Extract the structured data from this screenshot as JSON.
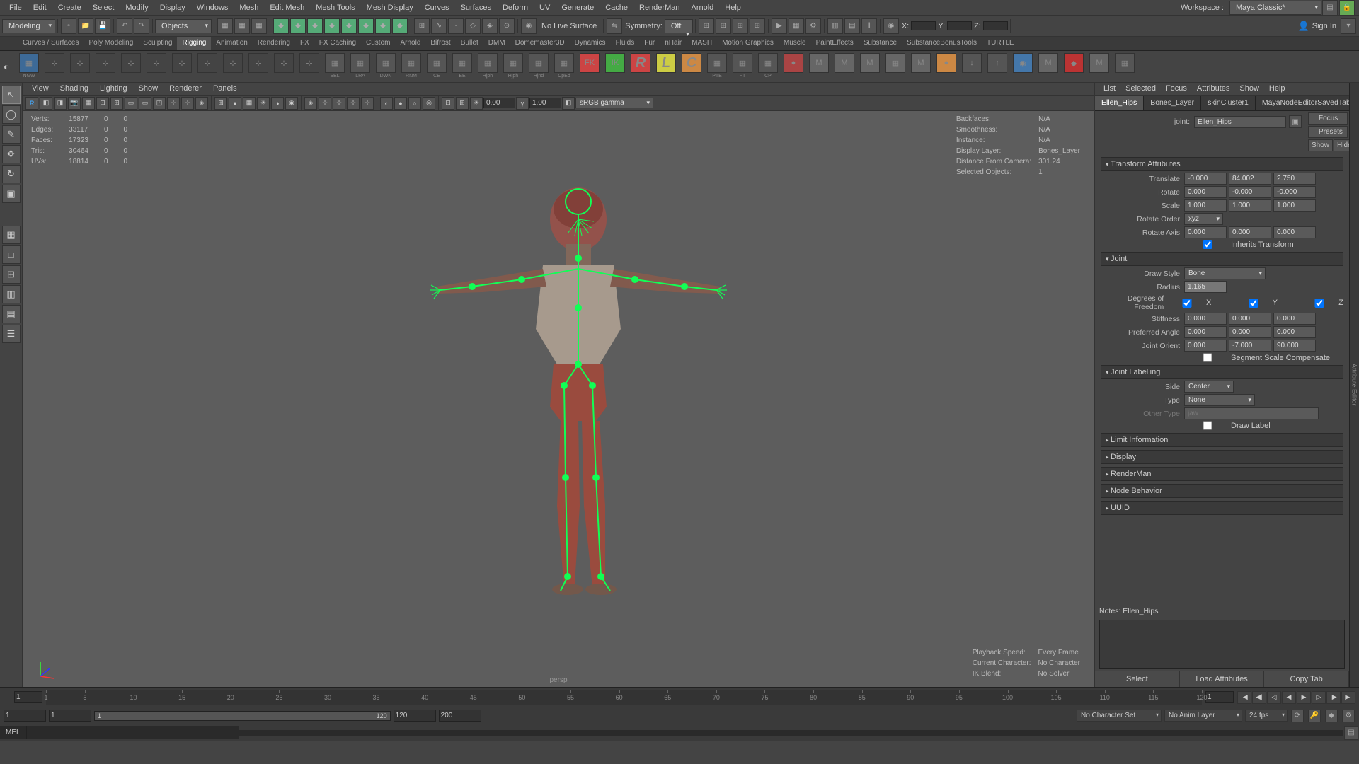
{
  "menubar": [
    "File",
    "Edit",
    "Create",
    "Select",
    "Modify",
    "Display",
    "Windows",
    "Mesh",
    "Edit Mesh",
    "Mesh Tools",
    "Mesh Display",
    "Curves",
    "Surfaces",
    "Deform",
    "UV",
    "Generate",
    "Cache",
    "RenderMan",
    "Arnold",
    "Help"
  ],
  "workspace_label": "Workspace :",
  "workspace_value": "Maya Classic*",
  "module_dropdown": "Modeling",
  "toolbar_search": "Objects",
  "status_items": {
    "nolive": "No Live Surface",
    "symmetry_label": "Symmetry:",
    "symmetry_value": "Off",
    "signin": "Sign In"
  },
  "xyz": {
    "x": "X:",
    "y": "Y:",
    "z": "Z:"
  },
  "shelf_tabs": [
    "Curves / Surfaces",
    "Poly Modeling",
    "Sculpting",
    "Rigging",
    "Animation",
    "Rendering",
    "FX",
    "FX Caching",
    "Custom",
    "Arnold",
    "Bifrost",
    "Bullet",
    "DMM",
    "Domemaster3D",
    "Dynamics",
    "Fluids",
    "Fur",
    "nHair",
    "MASH",
    "Motion Graphics",
    "Muscle",
    "PaintEffects",
    "Substance",
    "SubstanceBonusTools",
    "TURTLE"
  ],
  "shelf_active": 3,
  "shelf_icons": [
    {
      "lbl": "NGW",
      "bg": "#3d6a97",
      "txt": "▦"
    },
    {
      "lbl": "",
      "bg": "#444",
      "txt": "⊹"
    },
    {
      "lbl": "",
      "bg": "#444",
      "txt": "⊹"
    },
    {
      "lbl": "",
      "bg": "#444",
      "txt": "⊹"
    },
    {
      "lbl": "",
      "bg": "#444",
      "txt": "⊹"
    },
    {
      "lbl": "",
      "bg": "#444",
      "txt": "⊹"
    },
    {
      "lbl": "",
      "bg": "#444",
      "txt": "⊹"
    },
    {
      "lbl": "",
      "bg": "#444",
      "txt": "⊹"
    },
    {
      "lbl": "",
      "bg": "#444",
      "txt": "⊹"
    },
    {
      "lbl": "",
      "bg": "#444",
      "txt": "⊹"
    },
    {
      "lbl": "",
      "bg": "#444",
      "txt": "⊹"
    },
    {
      "lbl": "",
      "bg": "#444",
      "txt": "⊹"
    },
    {
      "lbl": "SEL",
      "bg": "#555",
      "txt": "▦"
    },
    {
      "lbl": "LRA",
      "bg": "#555",
      "txt": "▦"
    },
    {
      "lbl": "DWN",
      "bg": "#555",
      "txt": "▦"
    },
    {
      "lbl": "RNM",
      "bg": "#555",
      "txt": "▦"
    },
    {
      "lbl": "CE",
      "bg": "#555",
      "txt": "▦"
    },
    {
      "lbl": "EE",
      "bg": "#555",
      "txt": "▦"
    },
    {
      "lbl": "Hjph",
      "bg": "#555",
      "txt": "▦"
    },
    {
      "lbl": "Hjph",
      "bg": "#555",
      "txt": "▦"
    },
    {
      "lbl": "Hjnd",
      "bg": "#555",
      "txt": "▦"
    },
    {
      "lbl": "CpEd",
      "bg": "#555",
      "txt": "▦"
    },
    {
      "lbl": "",
      "bg": "#c44",
      "txt": "FK"
    },
    {
      "lbl": "",
      "bg": "#4a4",
      "txt": "IK"
    },
    {
      "lbl": "",
      "bg": "#c44",
      "txt": "R",
      "big": true
    },
    {
      "lbl": "",
      "bg": "#cc4",
      "txt": "L",
      "big": true
    },
    {
      "lbl": "",
      "bg": "#c84",
      "txt": "C",
      "big": true
    },
    {
      "lbl": "PTE",
      "bg": "#555",
      "txt": "▦"
    },
    {
      "lbl": "FT",
      "bg": "#555",
      "txt": "▦"
    },
    {
      "lbl": "CP",
      "bg": "#555",
      "txt": "▦"
    },
    {
      "lbl": "",
      "bg": "#a44",
      "txt": "●"
    },
    {
      "lbl": "",
      "bg": "#666",
      "txt": "M"
    },
    {
      "lbl": "",
      "bg": "#666",
      "txt": "M"
    },
    {
      "lbl": "",
      "bg": "#666",
      "txt": "M"
    },
    {
      "lbl": "",
      "bg": "#666",
      "txt": "▦"
    },
    {
      "lbl": "",
      "bg": "#666",
      "txt": "M"
    },
    {
      "lbl": "",
      "bg": "#c84",
      "txt": "●"
    },
    {
      "lbl": "",
      "bg": "#555",
      "txt": "↓"
    },
    {
      "lbl": "",
      "bg": "#555",
      "txt": "↑"
    },
    {
      "lbl": "",
      "bg": "#47a",
      "txt": "◉"
    },
    {
      "lbl": "",
      "bg": "#666",
      "txt": "M"
    },
    {
      "lbl": "",
      "bg": "#b33",
      "txt": "◆"
    },
    {
      "lbl": "",
      "bg": "#666",
      "txt": "M"
    },
    {
      "lbl": "",
      "bg": "#555",
      "txt": "▦"
    }
  ],
  "vp_menubar": [
    "View",
    "Shading",
    "Lighting",
    "Show",
    "Renderer",
    "Panels"
  ],
  "vp_toolbar_vals": {
    "exposure": "0.00",
    "gamma": "1.00",
    "colorspace": "sRGB gamma"
  },
  "hud_left": [
    [
      "Verts:",
      "15877",
      "0",
      "0"
    ],
    [
      "Edges:",
      "33117",
      "0",
      "0"
    ],
    [
      "Faces:",
      "17323",
      "0",
      "0"
    ],
    [
      "Tris:",
      "30464",
      "0",
      "0"
    ],
    [
      "UVs:",
      "18814",
      "0",
      "0"
    ]
  ],
  "hud_right": [
    [
      "Backfaces:",
      "N/A"
    ],
    [
      "Smoothness:",
      "N/A"
    ],
    [
      "Instance:",
      "N/A"
    ],
    [
      "Display Layer:",
      "Bones_Layer"
    ],
    [
      "Distance From Camera:",
      "301.24"
    ],
    [
      "Selected Objects:",
      "1"
    ]
  ],
  "hud_br": [
    [
      "Playback Speed:",
      "Every Frame"
    ],
    [
      "Current Character:",
      "No Character"
    ],
    [
      "IK Blend:",
      "No Solver"
    ]
  ],
  "persp_label": "persp",
  "rp_menubar": [
    "List",
    "Selected",
    "Focus",
    "Attributes",
    "Show",
    "Help"
  ],
  "rp_tabs": [
    "Ellen_Hips",
    "Bones_Layer",
    "skinCluster1",
    "MayaNodeEditorSavedTabs"
  ],
  "rp_tabs_active": 0,
  "rp_buttons": {
    "focus": "Focus",
    "presets": "Presets",
    "show": "Show",
    "hide": "Hide"
  },
  "joint_label": "joint:",
  "joint_name": "Ellen_Hips",
  "sections": {
    "transform": "Transform Attributes",
    "joint": "Joint",
    "jointlabel": "Joint Labelling",
    "limit": "Limit Information",
    "display": "Display",
    "renderman": "RenderMan",
    "nodebehavior": "Node Behavior",
    "uuid": "UUID"
  },
  "transform": {
    "translate_lbl": "Translate",
    "translate": [
      "-0.000",
      "84.002",
      "2.750"
    ],
    "rotate_lbl": "Rotate",
    "rotate": [
      "0.000",
      "-0.000",
      "-0.000"
    ],
    "scale_lbl": "Scale",
    "scale": [
      "1.000",
      "1.000",
      "1.000"
    ],
    "rotateorder_lbl": "Rotate Order",
    "rotateorder": "xyz",
    "rotateaxis_lbl": "Rotate Axis",
    "rotateaxis": [
      "0.000",
      "0.000",
      "0.000"
    ],
    "inherits_lbl": "Inherits Transform"
  },
  "joint_sec": {
    "drawstyle_lbl": "Draw Style",
    "drawstyle": "Bone",
    "radius_lbl": "Radius",
    "radius": "1.165",
    "dof_lbl": "Degrees of Freedom",
    "dof": [
      "X",
      "Y",
      "Z"
    ],
    "stiffness_lbl": "Stiffness",
    "stiffness": [
      "0.000",
      "0.000",
      "0.000"
    ],
    "prefangle_lbl": "Preferred Angle",
    "prefangle": [
      "0.000",
      "0.000",
      "0.000"
    ],
    "jointorient_lbl": "Joint Orient",
    "jointorient": [
      "0.000",
      "-7.000",
      "90.000"
    ],
    "segscale_lbl": "Segment Scale Compensate"
  },
  "jointlabel_sec": {
    "side_lbl": "Side",
    "side": "Center",
    "type_lbl": "Type",
    "type": "None",
    "othertype_lbl": "Other Type",
    "othertype": "jaw",
    "drawlabel_lbl": "Draw Label"
  },
  "notes_label": "Notes:",
  "notes_value": "Ellen_Hips",
  "rp_bottom": [
    "Select",
    "Load Attributes",
    "Copy Tab"
  ],
  "timeline": {
    "start": 1,
    "end": 120,
    "ticks": [
      1,
      5,
      10,
      15,
      20,
      25,
      30,
      35,
      40,
      45,
      50,
      55,
      60,
      65,
      70,
      75,
      80,
      85,
      90,
      95,
      100,
      105,
      110,
      115,
      120
    ],
    "current": "1"
  },
  "rangebar": {
    "a": "1",
    "b": "1",
    "c": "120",
    "d": "120",
    "e": "200",
    "charset": "No Character Set",
    "animlayer": "No Anim Layer",
    "fps": "24 fps"
  },
  "cmdline_lang": "MEL",
  "rside_label": "Attribute Editor"
}
